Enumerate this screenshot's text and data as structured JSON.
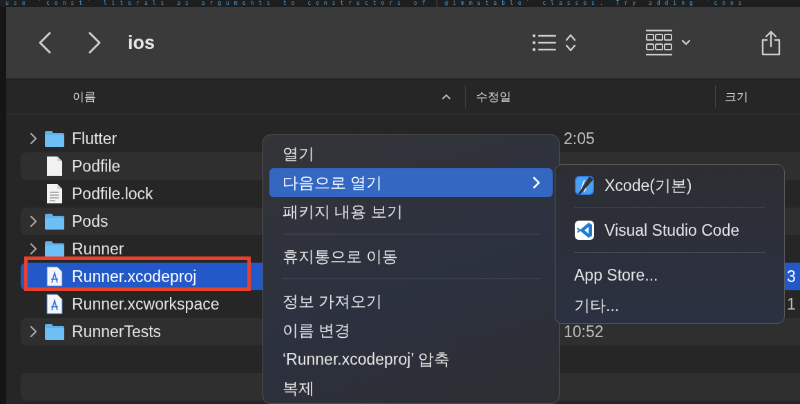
{
  "editor_strip": {
    "texts": [
      "use `const` literals as arguments to constructors of",
      "@immutable` classes. Try adding `cons"
    ]
  },
  "toolbar": {
    "title": "ios"
  },
  "columns": [
    {
      "label": "이름",
      "sorted": true
    },
    {
      "label": "수정일",
      "sorted": false
    },
    {
      "label": "크기",
      "sorted": false
    }
  ],
  "rows": [
    {
      "name": "Flutter",
      "kind": "folder",
      "selected": false,
      "outlined": false,
      "modified": "2:05"
    },
    {
      "name": "Podfile",
      "kind": "file",
      "selected": false,
      "outlined": false
    },
    {
      "name": "Podfile.lock",
      "kind": "text_file",
      "selected": false,
      "outlined": false
    },
    {
      "name": "Pods",
      "kind": "folder",
      "selected": false,
      "outlined": false
    },
    {
      "name": "Runner",
      "kind": "folder",
      "selected": false,
      "outlined": false
    },
    {
      "name": "Runner.xcodeproj",
      "kind": "project_file",
      "selected": true,
      "outlined": true,
      "size": "3"
    },
    {
      "name": "Runner.xcworkspace",
      "kind": "project_file",
      "selected": false,
      "outlined": false,
      "size": "1"
    },
    {
      "name": "RunnerTests",
      "kind": "folder",
      "selected": false,
      "outlined": false,
      "modified": "10:52"
    }
  ],
  "context_menu": {
    "items": [
      {
        "kind": "item",
        "label": "열기",
        "selected": false
      },
      {
        "kind": "submenu",
        "label": "다음으로 열기",
        "selected": true
      },
      {
        "kind": "item",
        "label": "패키지 내용 보기",
        "selected": false
      },
      {
        "kind": "separator"
      },
      {
        "kind": "item",
        "label": "휴지통으로 이동",
        "selected": false
      },
      {
        "kind": "separator"
      },
      {
        "kind": "item",
        "label": "정보 가져오기",
        "selected": false
      },
      {
        "kind": "item",
        "label": "이름 변경",
        "selected": false
      },
      {
        "kind": "item",
        "label": "‘Runner.xcodeproj’ 압축",
        "selected": false
      },
      {
        "kind": "item",
        "label": "복제",
        "selected": false
      }
    ]
  },
  "submenu": {
    "items": [
      {
        "kind": "app",
        "label": "Xcode(기본)"
      },
      {
        "kind": "separator"
      },
      {
        "kind": "app",
        "label": "Visual Studio Code"
      },
      {
        "kind": "separator"
      },
      {
        "kind": "item",
        "label": "App Store..."
      },
      {
        "kind": "item",
        "label": "기타..."
      }
    ]
  }
}
